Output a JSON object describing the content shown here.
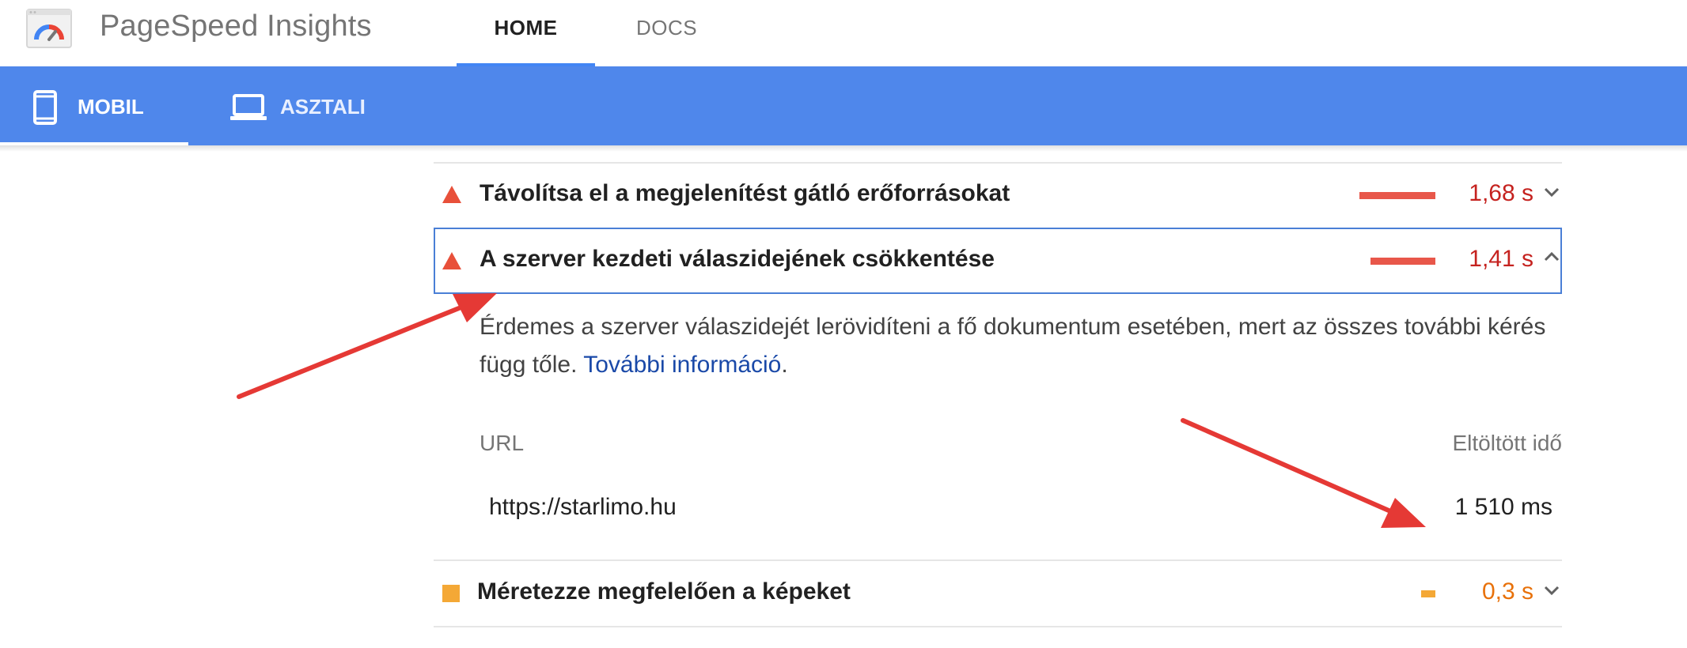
{
  "header": {
    "app_title": "PageSpeed Insights",
    "tabs": [
      {
        "label": "HOME",
        "active": true
      },
      {
        "label": "DOCS",
        "active": false
      }
    ]
  },
  "device_bar": {
    "accent_color": "#4f87eb",
    "tabs": [
      {
        "label": "MOBIL",
        "icon": "smartphone-icon",
        "active": true
      },
      {
        "label": "ASZTALI",
        "icon": "laptop-icon",
        "active": false
      }
    ]
  },
  "audits": [
    {
      "title": "Távolítsa el a megjelenítést gátló erőforrásokat",
      "value": "1,68 s",
      "severity": "fail",
      "color": "#c5221f",
      "expanded": false
    },
    {
      "title": "A szerver kezdeti válaszidejének csökkentése",
      "value": "1,41 s",
      "severity": "fail",
      "color": "#c5221f",
      "expanded": true
    },
    {
      "title": "Méretezze megfelelően a képeket",
      "value": "0,3 s",
      "severity": "average",
      "color": "#e8710a",
      "expanded": false
    }
  ],
  "details": {
    "description": "Érdemes a szerver válaszidejét lerövidíteni a fő dokumentum esetében, mert az összes további kérés függ tőle.",
    "link_text": "További információ",
    "link_suffix": ".",
    "table": {
      "headers": [
        "URL",
        "Eltöltött idő"
      ],
      "rows": [
        {
          "url": "https://starlimo.hu",
          "time": "1 510 ms"
        }
      ]
    }
  },
  "annotations": {
    "arrow_color": "#e53935"
  }
}
